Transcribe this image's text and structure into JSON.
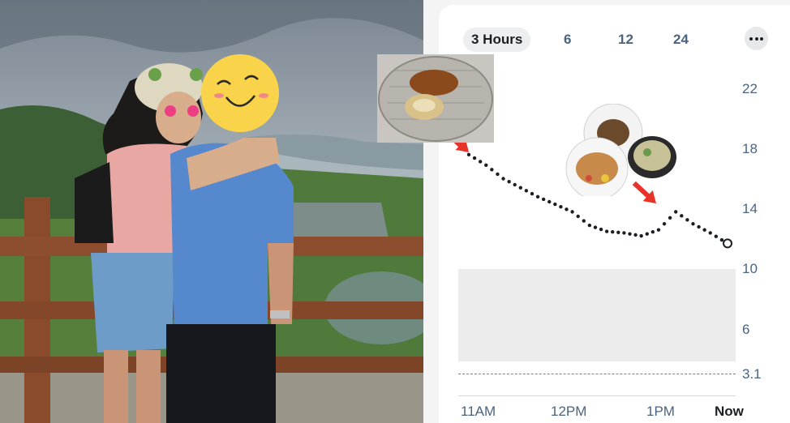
{
  "range_tabs": [
    {
      "label": "3 Hours",
      "active": true
    },
    {
      "label": "6",
      "active": false
    },
    {
      "label": "12",
      "active": false
    },
    {
      "label": "24",
      "active": false
    }
  ],
  "more_icon": "ellipsis-icon",
  "y_ticks": [
    "22",
    "18",
    "14",
    "10",
    "6",
    "3.1"
  ],
  "x_ticks": [
    "11AM",
    "12PM",
    "1PM",
    "Now"
  ],
  "target_range": [
    4,
    10
  ],
  "low_threshold": 3.1,
  "meal_icons": [
    "bread-plate-photo",
    "rice-and-soup-photo",
    "red-arrow-icon"
  ],
  "chart_data": {
    "type": "line",
    "x": [
      "11:00",
      "11:10",
      "11:20",
      "11:30",
      "11:40",
      "11:50",
      "12:00",
      "12:10",
      "12:20",
      "12:30",
      "12:40",
      "12:50",
      "13:00",
      "13:10",
      "13:20",
      "13:30"
    ],
    "series": [
      {
        "values": [
          17.6,
          16.9,
          16.0,
          15.4,
          14.8,
          14.3,
          13.8,
          12.9,
          12.5,
          12.4,
          12.2,
          12.6,
          13.8,
          13.0,
          12.4,
          11.7
        ]
      }
    ],
    "ylim": [
      1.8,
      23.5
    ],
    "target_range": [
      4,
      10
    ],
    "low_line": 3.1,
    "last_point": "Now"
  }
}
